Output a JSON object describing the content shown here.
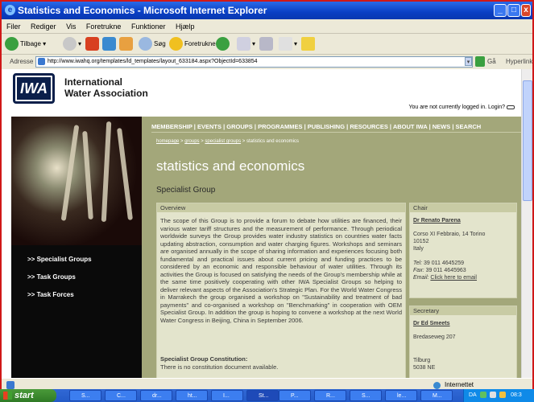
{
  "window": {
    "title": "Statistics and Economics - Microsoft Internet Explorer"
  },
  "menu": [
    "Filer",
    "Rediger",
    "Vis",
    "Foretrukne",
    "Funktioner",
    "Hjælp"
  ],
  "toolbar": {
    "back": "Tilbage",
    "search": "Søg",
    "favorites": "Foretrukne"
  },
  "address": {
    "label": "Adresse",
    "url": "http://www.iwahq.org/templates/ld_templates/layout_633184.aspx?ObjectId=633854",
    "go": "Gå",
    "links": "Hyperlinks"
  },
  "site": {
    "logo_text": "IWA",
    "org_line1": "International",
    "org_line2": "Water Association",
    "login_text": "You are not currently logged in. Login?"
  },
  "topnav": [
    "MEMBERSHIP",
    "EVENTS",
    "GROUPS",
    "PROGRAMMES",
    "PUBLISHING",
    "RESOURCES",
    "ABOUT IWA",
    "NEWS",
    "SEARCH"
  ],
  "breadcrumb": [
    "homepage",
    "groups",
    "specialist groups",
    "statistics and economics"
  ],
  "page": {
    "title": "statistics and economics",
    "subtitle": "Specialist Group"
  },
  "leftnav": [
    ">> Specialist Groups",
    ">> Task Groups",
    ">> Task Forces"
  ],
  "overview": {
    "heading": "Overview",
    "text": "The scope of this Group is to provide a forum to debate how utilities are financed, their various water tariff structures and the measurement of performance. Through periodical worldwide surveys the Group provides water industry statistics on countries water facts updating abstraction, consumption and water charging figures. Workshops and seminars are organised annually in the scope of sharing information and experiences focusing both fundamental and practical issues about current pricing and funding practices to be considered by an economic and responsible behaviour of water utilities. Through its activities the Group is focused on satisfying the needs of the Group's membership while at the same time positively cooperating with other IWA Specialist Groups so helping to deliver relevant aspects of the Association's Strategic Plan. For the World Water Congress in Marrakech the group organised a workshop on \"Sustainability and treatment of bad payments\" and co-organised a workshop on \"Benchmarking\" in cooperation with OEM Specialist Group. In addition the group is hoping to convene a workshop at the next World Water Congress in Beijing, China in September 2006.",
    "constitution_heading": "Specialist Group Constitution:",
    "constitution_text": "There is no constitution document available."
  },
  "chair": {
    "heading": "Chair",
    "name": "Dr Renato Parena",
    "address1": "Corso XI Febbraio, 14 Torino",
    "address2": "10152",
    "address3": "Italy",
    "tel_label": "Tel:",
    "tel": "39 011 4645259",
    "fax_label": "Fax:",
    "fax": "39 011 4645963",
    "email_label": "Email:",
    "email_link": "Click here to email"
  },
  "secretary": {
    "heading": "Secretary",
    "name": "Dr Ed Smeets",
    "address1": "Bredaseweg 207",
    "address2": "Tilburg",
    "address3": "5038 NE"
  },
  "statusbar": {
    "zone": "Internettet"
  },
  "taskbar": {
    "start": "start",
    "tasks": [
      "S...",
      "C...",
      "dr...",
      "ht...",
      "I...",
      "St...",
      "P...",
      "R...",
      "S...",
      "le...",
      "M..."
    ],
    "tray_text": "DA",
    "clock": "08:3"
  }
}
